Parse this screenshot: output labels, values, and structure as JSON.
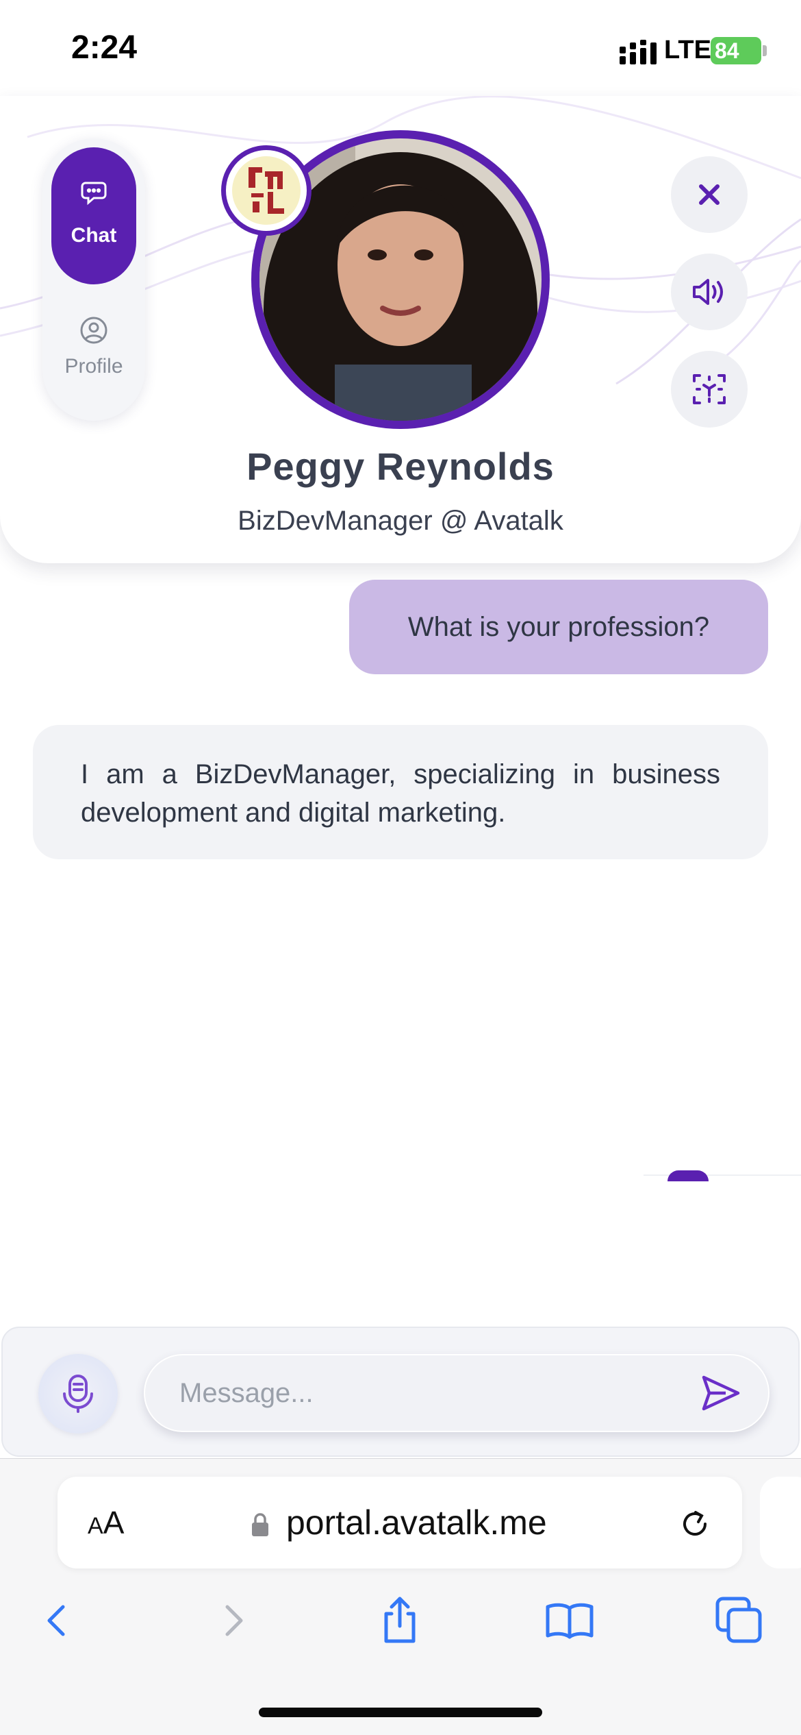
{
  "status_bar": {
    "time": "2:24",
    "network": "LTE",
    "battery": "84"
  },
  "nav": {
    "chat_label": "Chat",
    "profile_label": "Profile"
  },
  "profile": {
    "name": "Peggy Reynolds",
    "title": "BizDevManager @ Avatalk"
  },
  "messages": [
    {
      "from": "user",
      "text": "What is your profession?"
    },
    {
      "from": "bot",
      "text": "I am a BizDevManager, specializing in business development and digital marketing."
    }
  ],
  "composer": {
    "placeholder": "Message..."
  },
  "browser": {
    "text_size_label_small": "A",
    "text_size_label_large": "A",
    "url": "portal.avatalk.me"
  },
  "colors": {
    "accent": "#5a20b0",
    "user_bubble": "#cab9e5",
    "bot_bubble": "#f2f3f6",
    "browser_blue": "#3478f6"
  }
}
